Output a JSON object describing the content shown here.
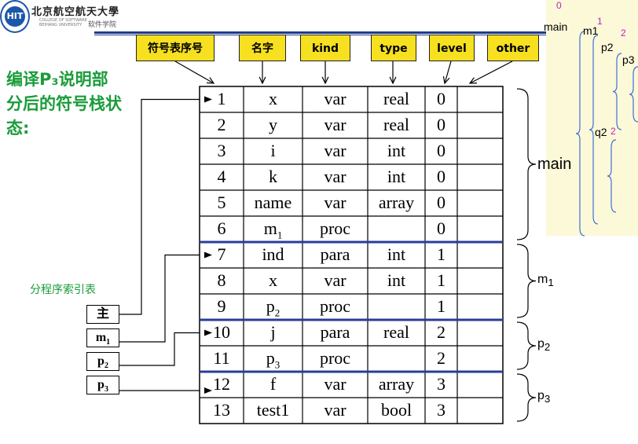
{
  "logo": {
    "badge": "HIT",
    "university": "北京航空航天大學",
    "subtitle": "COLLEGE OF SOFTWARE BEIHANG UNIVERSITY",
    "school": "软件学院"
  },
  "caption": "编译P₃说明部分后的符号栈状态:",
  "index_table": {
    "title": "分程序索引表",
    "items": [
      {
        "name": "主",
        "sub": ""
      },
      {
        "name": "m",
        "sub": "1"
      },
      {
        "name": "p",
        "sub": "2"
      },
      {
        "name": "p",
        "sub": "3"
      }
    ]
  },
  "headers": [
    "符号表序号",
    "名字",
    "kind",
    "type",
    "level",
    "other"
  ],
  "rows": [
    {
      "num": "1",
      "name": "x",
      "name_sub": "",
      "kind": "var",
      "type": "real",
      "level": "0"
    },
    {
      "num": "2",
      "name": "y",
      "name_sub": "",
      "kind": "var",
      "type": "real",
      "level": "0"
    },
    {
      "num": "3",
      "name": "i",
      "name_sub": "",
      "kind": "var",
      "type": "int",
      "level": "0"
    },
    {
      "num": "4",
      "name": "k",
      "name_sub": "",
      "kind": "var",
      "type": "int",
      "level": "0"
    },
    {
      "num": "5",
      "name": "name",
      "name_sub": "",
      "kind": "var",
      "type": "array",
      "level": "0"
    },
    {
      "num": "6",
      "name": "m",
      "name_sub": "1",
      "kind": "proc",
      "type": "",
      "level": "0"
    },
    {
      "num": "7",
      "name": "ind",
      "name_sub": "",
      "kind": "para",
      "type": "int",
      "level": "1"
    },
    {
      "num": "8",
      "name": "x",
      "name_sub": "",
      "kind": "var",
      "type": "int",
      "level": "1"
    },
    {
      "num": "9",
      "name": "p",
      "name_sub": "2",
      "kind": "proc",
      "type": "",
      "level": "1"
    },
    {
      "num": "10",
      "name": "j",
      "name_sub": "",
      "kind": "para",
      "type": "real",
      "level": "2"
    },
    {
      "num": "11",
      "name": "p",
      "name_sub": "3",
      "kind": "proc",
      "type": "",
      "level": "2"
    },
    {
      "num": "12",
      "name": "f",
      "name_sub": "",
      "kind": "var",
      "type": "array",
      "level": "3"
    },
    {
      "num": "13",
      "name": "test1",
      "name_sub": "",
      "kind": "var",
      "type": "bool",
      "level": "3"
    }
  ],
  "scopes": [
    {
      "name": "main",
      "sub": ""
    },
    {
      "name": "m",
      "sub": "1"
    },
    {
      "name": "p",
      "sub": "2"
    },
    {
      "name": "p",
      "sub": "3"
    }
  ],
  "nesting": {
    "main": "main",
    "m1": "m1",
    "p2": "p2",
    "p3": "p3",
    "q2": "q2",
    "lvl0": "0",
    "lvl1": "1",
    "lvl2a": "2",
    "lvl2b": "2"
  },
  "colors": {
    "accent_green": "#1a9c3a",
    "header_yellow": "#f6e020",
    "divider_blue": "#2a3c9a",
    "panel_bg": "#fbf9d8",
    "brace_blue": "#3f6fd8",
    "magenta": "#c020c0"
  }
}
